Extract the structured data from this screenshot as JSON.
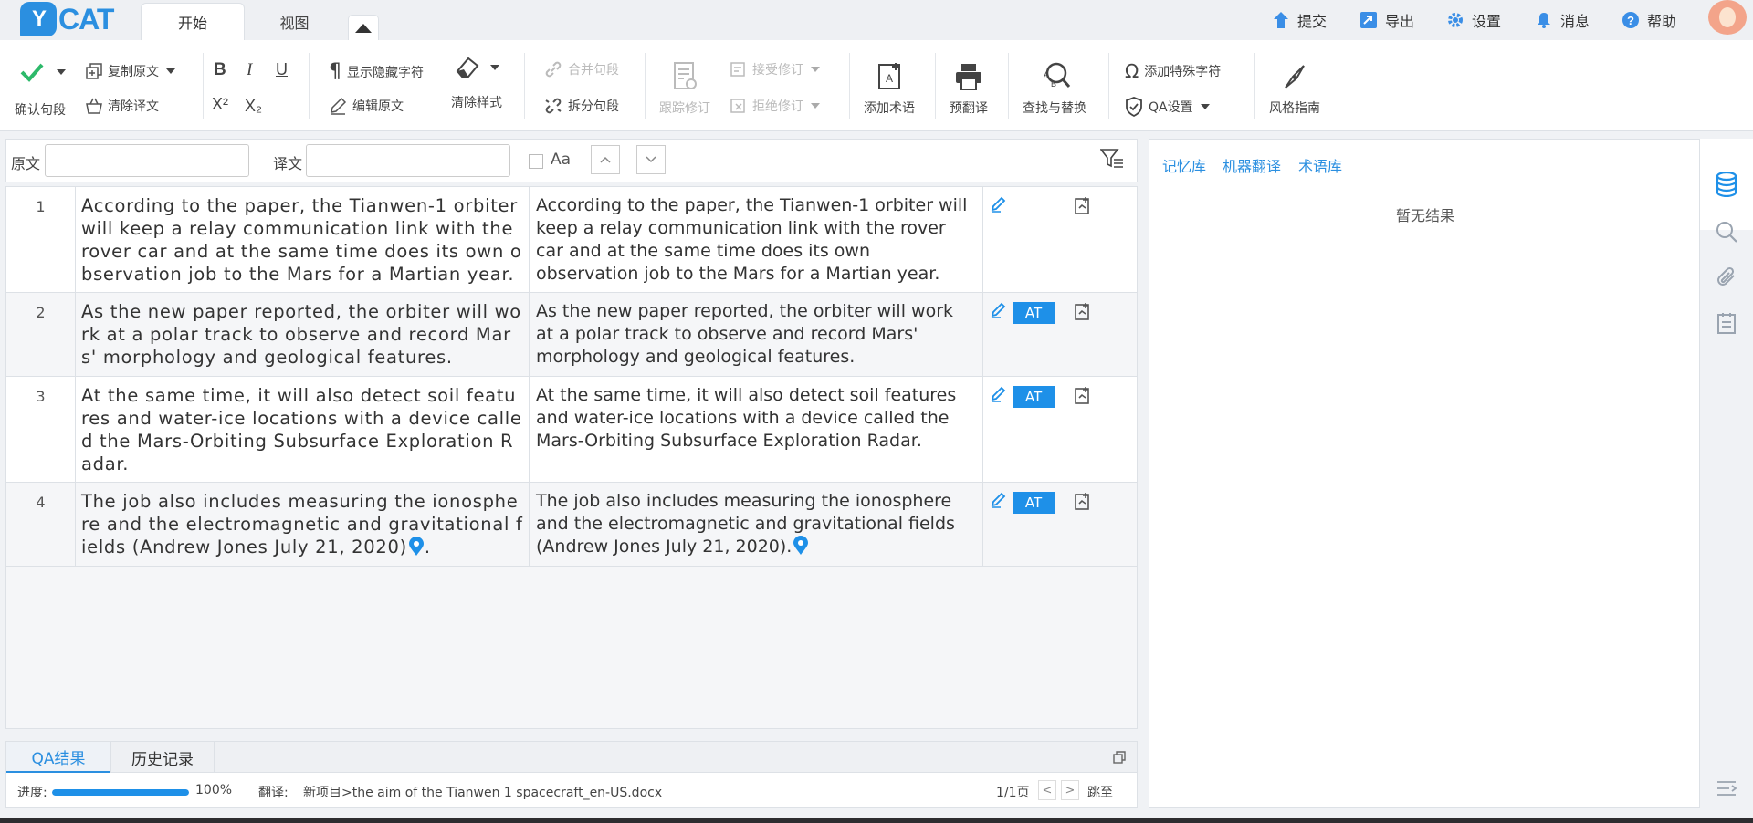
{
  "app": {
    "logo_y": "Y",
    "logo_cat": "CAT"
  },
  "tabs": {
    "start": "开始",
    "view": "视图"
  },
  "top_actions": {
    "submit": "提交",
    "export": "导出",
    "settings": "设置",
    "messages": "消息",
    "help": "帮助"
  },
  "ribbon": {
    "confirm_segment": "确认句段",
    "copy_source": "复制原文",
    "clear_translation": "清除译文",
    "bold": "B",
    "italic": "I",
    "underline": "U",
    "superscript": "X²",
    "subscript": "X₂",
    "show_hidden_chars": "显示隐藏字符",
    "edit_source": "编辑原文",
    "clear_style": "清除样式",
    "merge_segment": "合并句段",
    "split_segment": "拆分句段",
    "track_changes": "跟踪修订",
    "accept_changes": "接受修订",
    "reject_changes": "拒绝修订",
    "add_term": "添加术语",
    "pre_translate": "预翻译",
    "find_replace": "查找与替换",
    "add_special_char": "添加特殊字符",
    "qa_settings": "QA设置",
    "style_guide": "风格指南"
  },
  "search": {
    "source_label": "原文",
    "target_label": "译文",
    "match_case": "Aa"
  },
  "segments": [
    {
      "num": "1",
      "source": "According to the paper, the Tianwen-1 orbiter will keep a relay communication link with the rover car and at the same time does its own observation job to the Mars for a Martian year.",
      "target": "According to the paper, the Tianwen-1 orbiter will keep a relay communication link with the rover car and at the same time does its own observation job to the Mars for a Martian year.",
      "badge": ""
    },
    {
      "num": "2",
      "source": "As the new paper reported, the orbiter will work at a polar track to observe and record Mars' morphology and geological features.",
      "target": "As the new paper reported, the orbiter will work at a polar track to observe and record Mars' morphology and geological features.",
      "badge": "AT"
    },
    {
      "num": "3",
      "source": "At the same time, it will also detect soil features and water-ice locations with a device called the Mars-Orbiting Subsurface Exploration Radar.",
      "target": "At the same time, it will also detect soil features and water-ice locations with a device called the Mars-Orbiting Subsurface Exploration Radar.",
      "badge": "AT"
    },
    {
      "num": "4",
      "source": "The job also includes measuring the ionosphere and the electromagnetic and gravitational fields (Andrew Jones July 21, 2020)",
      "source_tail": ".",
      "target": "The job also includes measuring the ionosphere and the electromagnetic and gravitational fields (Andrew Jones July 21, 2020).",
      "badge": "AT"
    }
  ],
  "bottom": {
    "tab_qa": "QA结果",
    "tab_history": "历史记录",
    "progress_label": "进度:",
    "progress_value": "100%",
    "progress_fraction": 1.0,
    "translate_label": "翻译:",
    "file_path": "新项目>the aim of the Tianwen 1 spacecraft_en-US.docx",
    "page_info": "1/1页",
    "prev": "<",
    "next": ">",
    "jump": "跳至"
  },
  "right_panel": {
    "tm": "记忆库",
    "mt": "机器翻译",
    "termbase": "术语库",
    "no_result": "暂无结果"
  },
  "colors": {
    "accent": "#1e90e8",
    "brand": "#2b8fe0"
  }
}
